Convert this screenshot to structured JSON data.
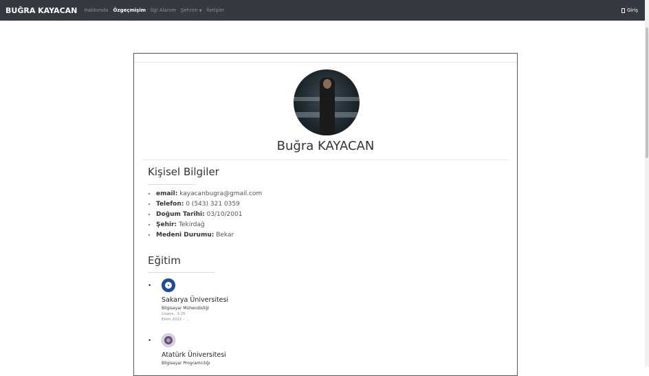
{
  "navbar": {
    "brand": "BUĞRA KAYACAN",
    "links": [
      "Hakkımda",
      "Özgeçmişim",
      "İlgi Alanım",
      "Şehrim",
      "İletişim"
    ],
    "active": "Özgeçmişim",
    "login_label": "Giriş"
  },
  "profile": {
    "name": "Buğra KAYACAN"
  },
  "personal": {
    "title": "Kişisel Bilgiler",
    "items": [
      {
        "label": "email:",
        "value": "kayacanbugra@gmail.com"
      },
      {
        "label": "Telefon:",
        "value": "0 (543) 321 0359"
      },
      {
        "label": "Doğum Tarihi:",
        "value": "03/10/2001"
      },
      {
        "label": "Şehir:",
        "value": "Tekirdağ"
      },
      {
        "label": "Medeni Durumu:",
        "value": "Bekar"
      }
    ]
  },
  "education": {
    "title": "Eğitim",
    "items": [
      {
        "school": "Sakarya Üniversitesi",
        "department": "Bilgisayar Mühendisliği",
        "degree": "Lisans , 3.25",
        "dates": "Ekim 2022 - ..."
      },
      {
        "school": "Atatürk Üniversitesi",
        "department": "Bilgisayar Programcılığı"
      }
    ]
  },
  "icons": {
    "login": "door-icon",
    "dropdown": "caret-down-icon"
  }
}
